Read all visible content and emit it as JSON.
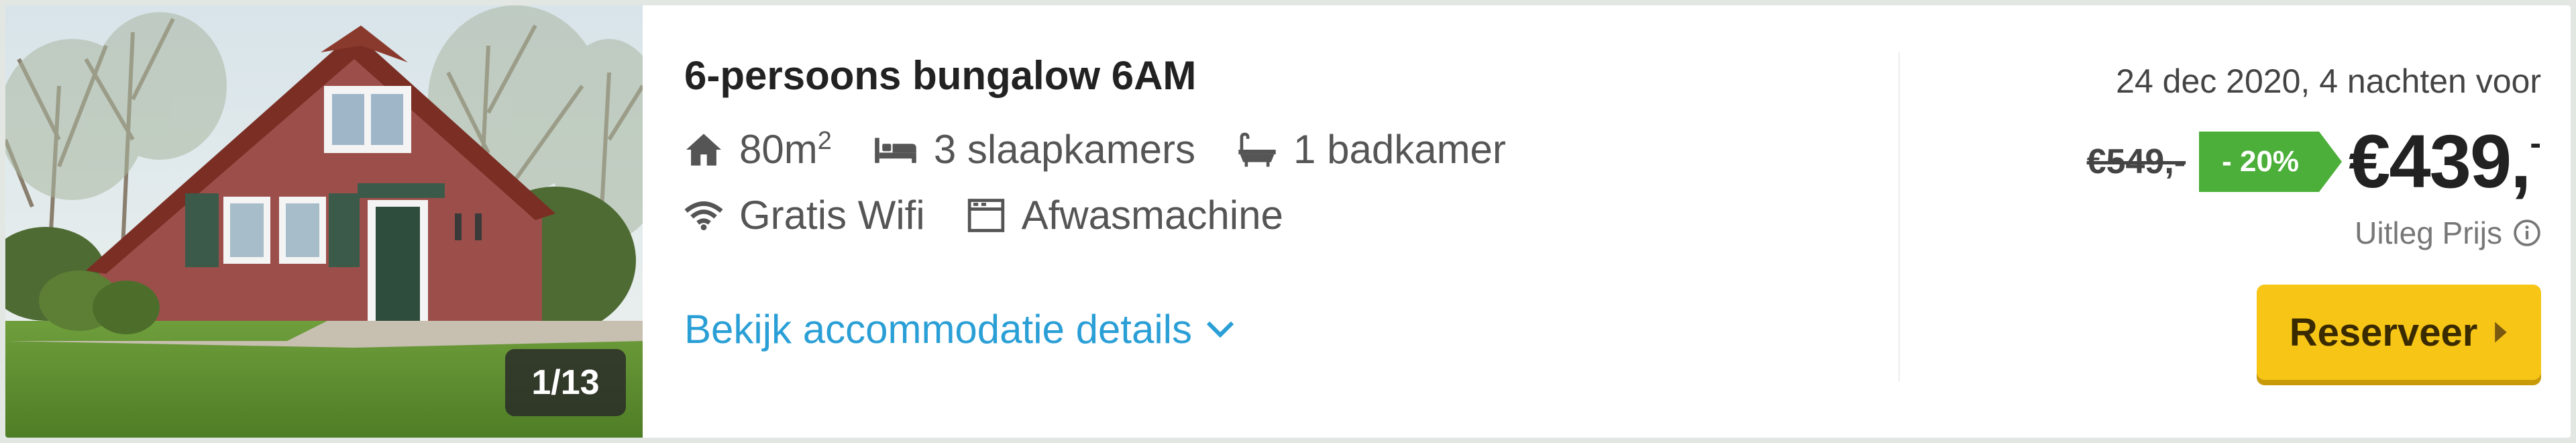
{
  "listing": {
    "title": "6-persoons bungalow 6AM",
    "image_counter": "1/13",
    "features": {
      "area": "80m",
      "area_sup": "2",
      "bedrooms": "3 slaapkamers",
      "bathrooms": "1 badkamer",
      "wifi": "Gratis Wifi",
      "dishwasher": "Afwasmachine"
    },
    "details_link": "Bekijk accommodatie details"
  },
  "pricing": {
    "date_info": "24 dec 2020, 4 nachten voor",
    "old_price": "€549,-",
    "discount": "- 20%",
    "new_price": "€439,",
    "new_price_suffix": "-",
    "explain": "Uitleg Prijs",
    "reserve_button": "Reserveer"
  },
  "icons": {
    "area": "house-icon",
    "bedrooms": "bed-icon",
    "bathrooms": "bathtub-icon",
    "wifi": "wifi-icon",
    "dishwasher": "dishwasher-icon",
    "details": "chevron-down-icon",
    "explain": "info-icon",
    "reserve": "caret-right-icon"
  },
  "colors": {
    "link": "#2a9fd6",
    "discount_badge": "#4caf3a",
    "reserve_button": "#f6c516"
  }
}
